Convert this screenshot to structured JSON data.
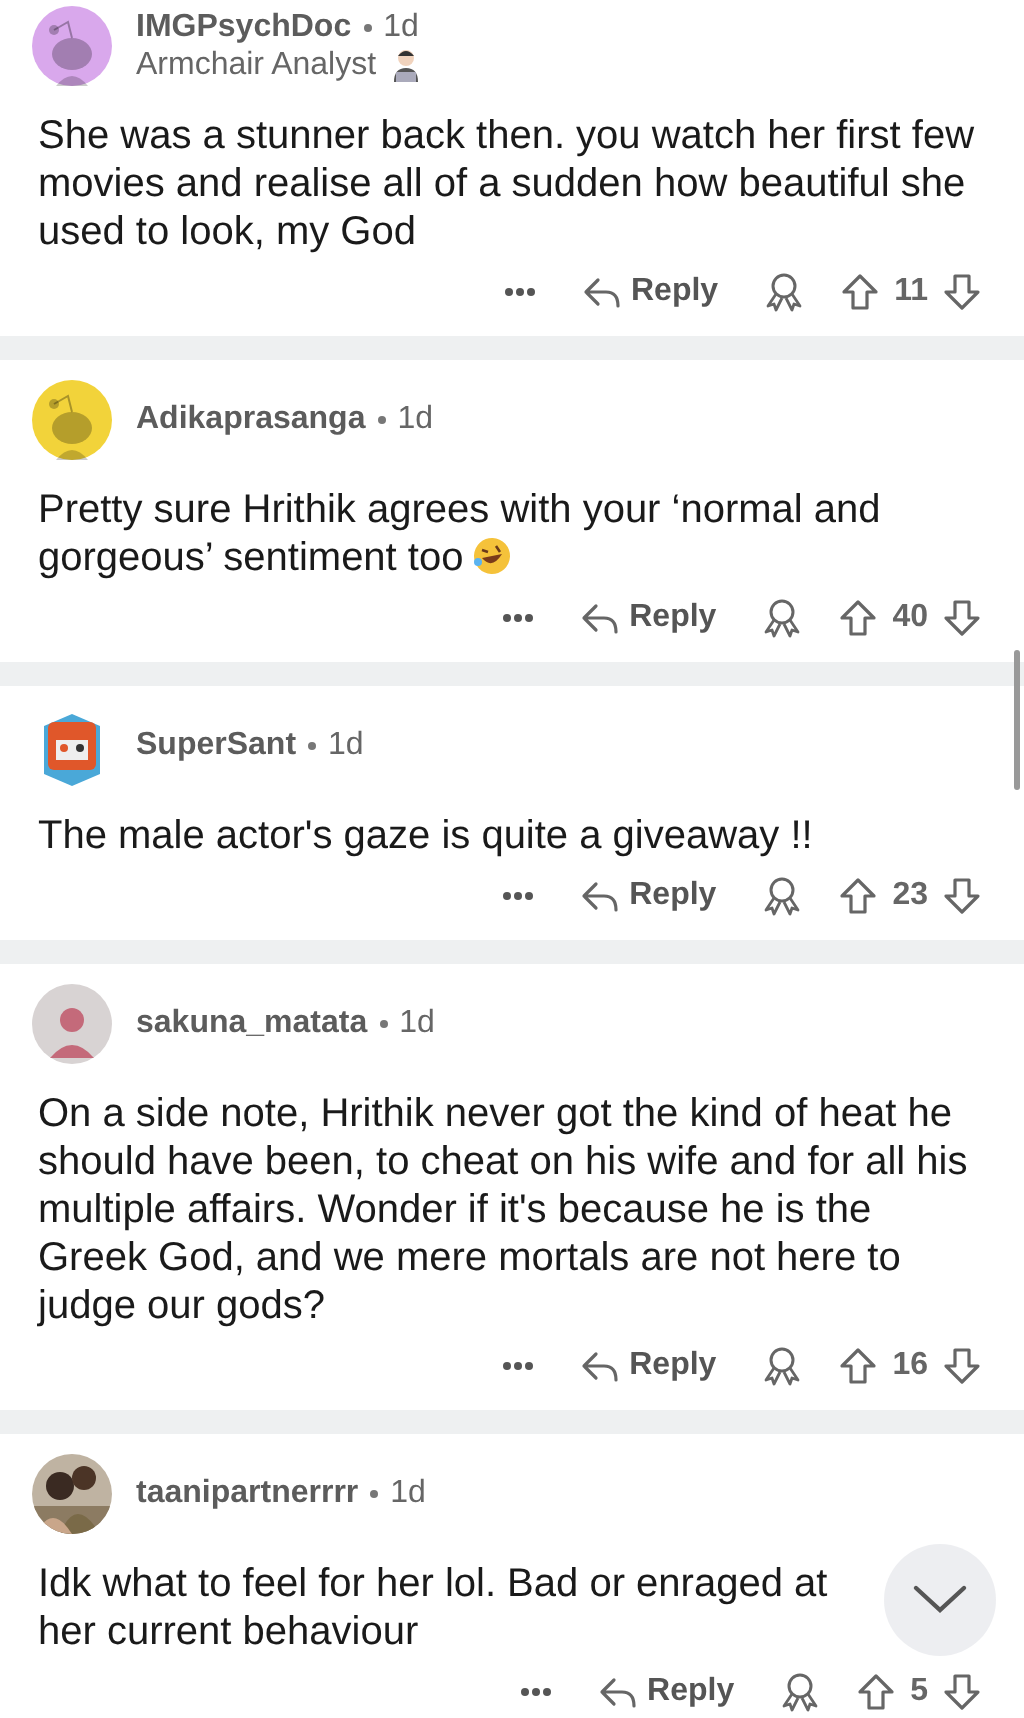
{
  "comments": [
    {
      "avatar": {
        "kind": "snoo",
        "color": "#d9a8ec"
      },
      "username": "IMGPsychDoc",
      "age": "1d",
      "flair": {
        "text": "Armchair Analyst",
        "icon": true
      },
      "body": "She was a stunner back then. you watch her first few movies and realise all of a sudden how beautiful she used to look, my God",
      "emoji": false,
      "reply": "Reply",
      "votes": "11"
    },
    {
      "avatar": {
        "kind": "snoo",
        "color": "#f2d33a"
      },
      "username": "Adikaprasanga",
      "age": "1d",
      "body": "Pretty sure Hrithik agrees with your ‘normal and gorgeous’ sentiment too",
      "emoji": true,
      "reply": "Reply",
      "votes": "40"
    },
    {
      "avatar": {
        "kind": "robot",
        "color": "#e0572a"
      },
      "username": "SuperSant",
      "age": "1d",
      "body": "The male actor's gaze is quite a giveaway !!",
      "emoji": false,
      "reply": "Reply",
      "votes": "23"
    },
    {
      "avatar": {
        "kind": "person",
        "color": "#d8d3d3"
      },
      "username": "sakuna_matata",
      "age": "1d",
      "body": "On a side note, Hrithik never got the kind of heat he should have been, to cheat on his wife and for all his multiple affairs. Wonder if it's because he is the Greek God, and we mere mortals are not here to judge our gods?",
      "emoji": false,
      "reply": "Reply",
      "votes": "16"
    },
    {
      "username": "taanipartnerrrr",
      "age": "1d",
      "body": "Idk what to feel for her lol. Bad or enraged at her current behaviour",
      "emoji": false,
      "reply": "Reply",
      "votes": "5"
    }
  ]
}
